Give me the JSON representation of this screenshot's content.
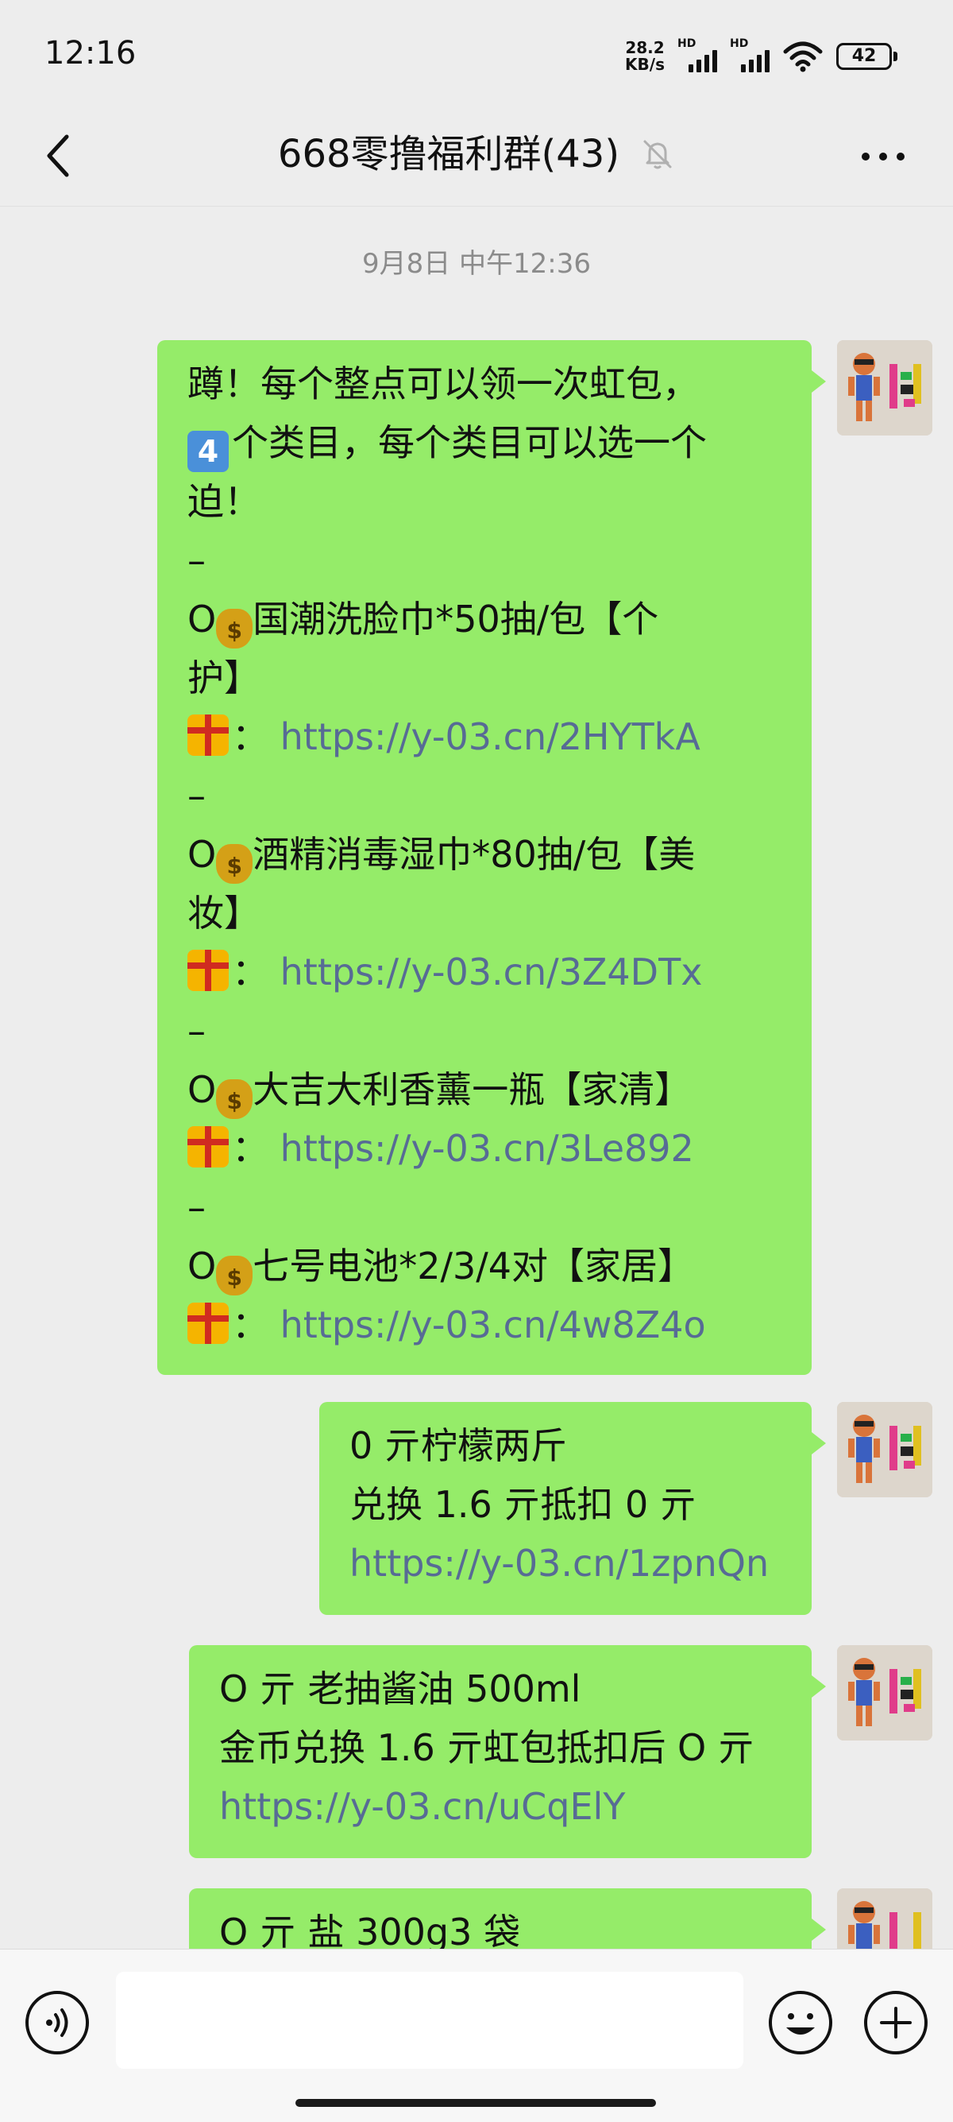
{
  "status_bar": {
    "time": "12:16",
    "net_speed_value": "28.2",
    "net_speed_unit": "KB/s",
    "signal1_label": "HD",
    "signal2_label": "HD",
    "battery": "42"
  },
  "header": {
    "title": "668零撸福利群(43)",
    "back_icon": "chevron-left-icon",
    "mute_icon": "bell-muted-icon",
    "more_icon": "more-dots-icon"
  },
  "chat": {
    "timestamp": "9月8日 中午12:36",
    "msg1": {
      "l1": "蹲！每个整点可以领一次虹包，",
      "l2_rest": "个类目，每个类目可以选一个",
      "l3": "迫！",
      "sep": "–",
      "item1_a": "国潮洗脸巾*50抽/包【个",
      "item1_b": "护】",
      "link1": "https://y-03.cn/2HYTkA",
      "item2_a": "酒精消毒湿巾*80抽/包【美",
      "item2_b": "妆】",
      "link2": "https://y-03.cn/3Z4DTx",
      "item3": "大吉大利香薰一瓶【家清】",
      "link3": "https://y-03.cn/3Le892",
      "item4": "七号电池*2/3/4对【家居】",
      "link4": "https://y-03.cn/4w8Z4o",
      "o_prefix": "O",
      "colon": "："
    },
    "msg2": {
      "l1": "0 亓柠檬两斤",
      "l2": "兑换 1.6 亓抵扣 0 亓",
      "link": "https://y-03.cn/1zpnQn"
    },
    "msg3": {
      "l1": "O 亓 老抽酱油 500ml",
      "l2": "金币兑换 1.6 亓虹包抵扣后 O 亓",
      "link": "https://y-03.cn/uCqElY"
    },
    "msg4": {
      "l1": "O 亓 盐 300g3 袋"
    }
  },
  "input_bar": {
    "voice_icon": "voice-icon",
    "emoji_icon": "emoji-icon",
    "plus_icon": "plus-icon",
    "input_value": ""
  },
  "colors": {
    "bubble": "#95ec69",
    "link": "#576b95",
    "background": "#ededed"
  }
}
